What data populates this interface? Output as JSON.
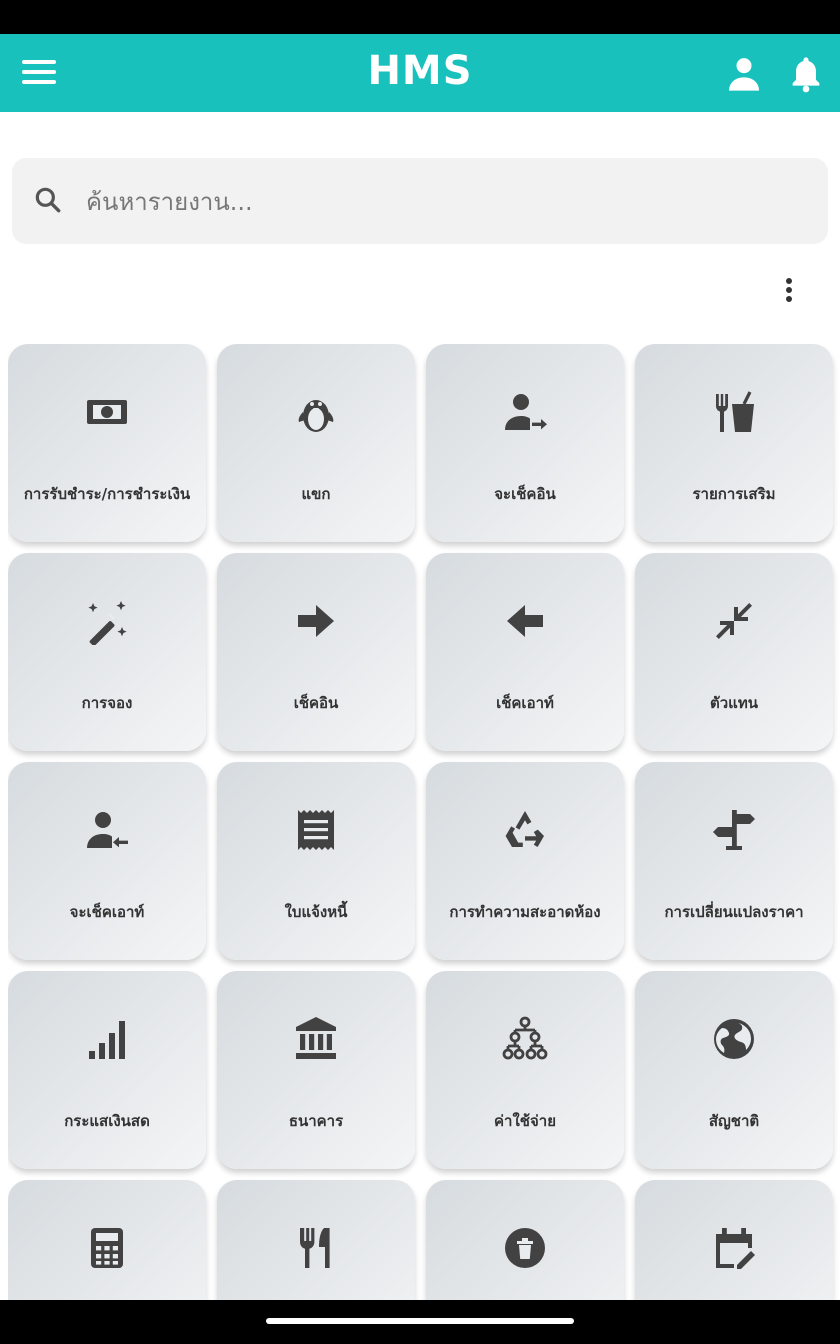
{
  "header": {
    "title": "HMS",
    "accent_color": "#19c1bd",
    "icons": [
      "menu-icon",
      "person-icon",
      "bell-icon"
    ]
  },
  "search": {
    "placeholder": "ค้นหารายงาน...",
    "value": ""
  },
  "tiles": [
    {
      "label": "การรับชำระ/การชำระเงิน",
      "icon": "banknote-icon"
    },
    {
      "label": "แขก",
      "icon": "penguin-icon"
    },
    {
      "label": "จะเช็คอิน",
      "icon": "person-arrow-right-icon"
    },
    {
      "label": "รายการเสริม",
      "icon": "fork-cup-icon"
    },
    {
      "label": "การจอง",
      "icon": "magic-wand-icon"
    },
    {
      "label": "เช็คอิน",
      "icon": "arrow-right-icon"
    },
    {
      "label": "เช็คเอาท์",
      "icon": "arrow-left-icon"
    },
    {
      "label": "ตัวแทน",
      "icon": "compress-icon"
    },
    {
      "label": "จะเช็คเอาท์",
      "icon": "person-arrow-left-icon"
    },
    {
      "label": "ใบแจ้งหนี้",
      "icon": "receipt-icon"
    },
    {
      "label": "การทำความสะอาดห้อง",
      "icon": "recycle-icon"
    },
    {
      "label": "การเปลี่ยนแปลงราคา",
      "icon": "signpost-icon"
    },
    {
      "label": "กระแสเงินสด",
      "icon": "signal-bars-icon"
    },
    {
      "label": "ธนาคาร",
      "icon": "bank-icon"
    },
    {
      "label": "ค่าใช้จ่าย",
      "icon": "hierarchy-icon"
    },
    {
      "label": "สัญชาติ",
      "icon": "globe-icon"
    },
    {
      "label": "",
      "icon": "calculator-icon"
    },
    {
      "label": "",
      "icon": "utensils-icon"
    },
    {
      "label": "",
      "icon": "trash-circle-icon"
    },
    {
      "label": "",
      "icon": "calendar-edit-icon"
    }
  ]
}
